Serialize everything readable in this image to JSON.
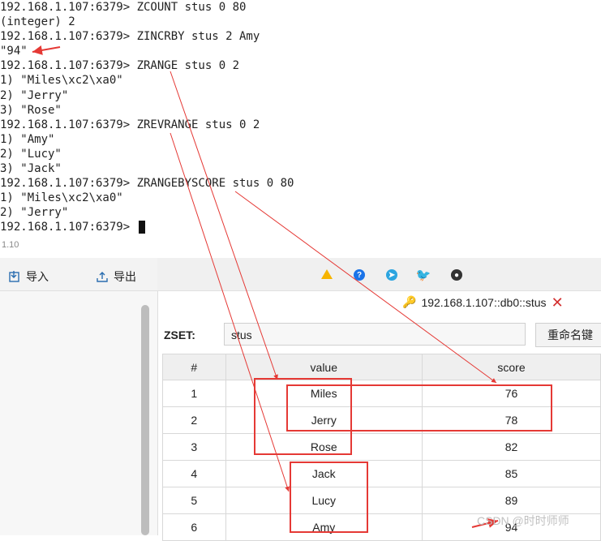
{
  "terminal": {
    "lines": [
      "192.168.1.107:6379> ZCOUNT stus 0 80",
      "(integer) 2",
      "192.168.1.107:6379> ZINCRBY stus 2 Amy",
      "\"94\"",
      "192.168.1.107:6379> ZRANGE stus 0 2",
      "1) \"Miles\\xc2\\xa0\"",
      "2) \"Jerry\"",
      "3) \"Rose\"",
      "192.168.1.107:6379> ZREVRANGE stus 0 2",
      "1) \"Amy\"",
      "2) \"Lucy\"",
      "3) \"Jack\"",
      "192.168.1.107:6379> ZRANGEBYSCORE stus 0 80",
      "1) \"Miles\\xc2\\xa0\"",
      "2) \"Jerry\"",
      "192.168.1.107:6379> "
    ]
  },
  "app": {
    "version": "1.10",
    "toolbar": {
      "import_label": "导入",
      "export_label": "导出"
    },
    "tab": {
      "label": "192.168.1.107::db0::stus"
    },
    "zset": {
      "type_label": "ZSET:",
      "key_name": "stus",
      "rename_label": "重命名键"
    },
    "table": {
      "headers": [
        "#",
        "value",
        "score"
      ],
      "rows": [
        {
          "idx": "1",
          "value": "Miles",
          "score": "76"
        },
        {
          "idx": "2",
          "value": "Jerry",
          "score": "78"
        },
        {
          "idx": "3",
          "value": "Rose",
          "score": "82"
        },
        {
          "idx": "4",
          "value": "Jack",
          "score": "85"
        },
        {
          "idx": "5",
          "value": "Lucy",
          "score": "89"
        },
        {
          "idx": "6",
          "value": "Amy",
          "score": "94"
        }
      ]
    }
  },
  "icons": {
    "warning": "warning-icon",
    "help": "help-icon",
    "telegram": "telegram-icon",
    "twitter": "twitter-icon",
    "github": "github-icon",
    "key": "key-icon",
    "close": "close-icon"
  },
  "watermark": "CSDN @时时师师",
  "colors": {
    "annotation": "#e53935"
  }
}
